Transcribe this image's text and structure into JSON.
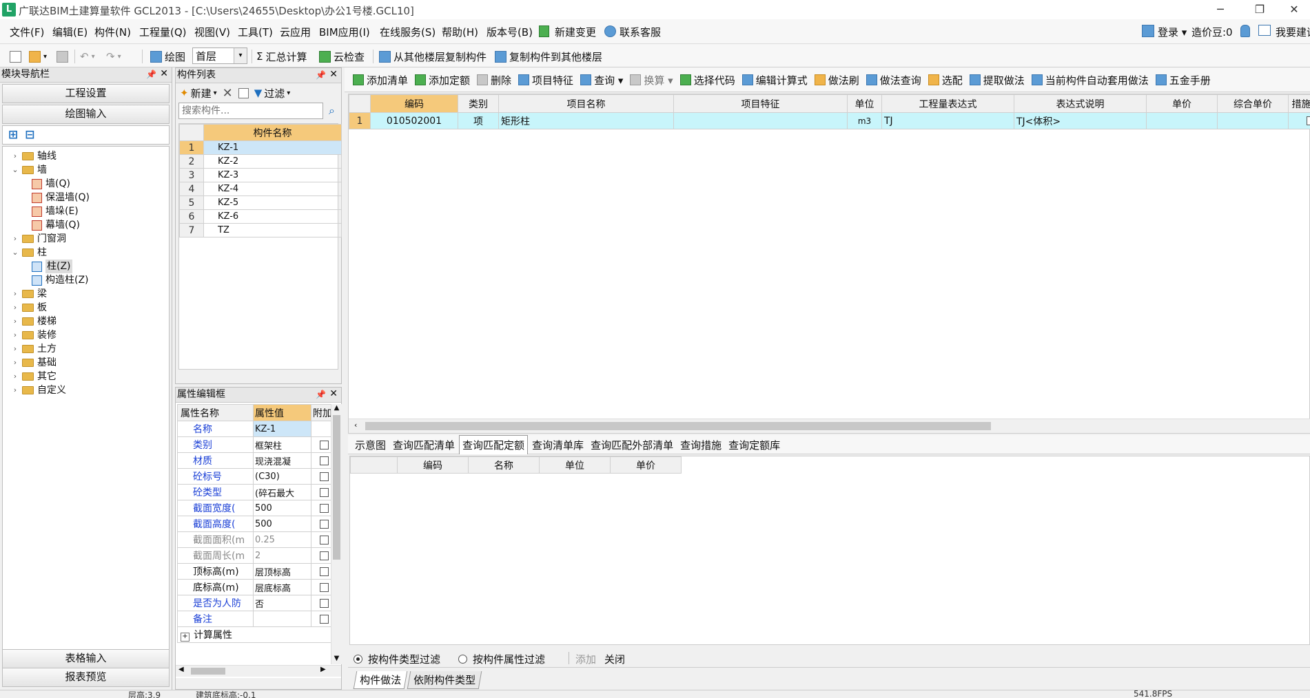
{
  "window": {
    "title": "广联达BIM土建算量软件 GCL2013 - [C:\\Users\\24655\\Desktop\\办公1号楼.GCL10]",
    "logo": "L"
  },
  "menu": [
    "文件(F)",
    "编辑(E)",
    "构件(N)",
    "工程量(Q)",
    "视图(V)",
    "工具(T)",
    "云应用",
    "BIM应用(I)",
    "在线服务(S)",
    "帮助(H)",
    "版本号(B)",
    "新建变更",
    "联系客服"
  ],
  "account": {
    "login": "登录 ▾",
    "price_bean": "造价豆:0",
    "build": "我要建议"
  },
  "toolbar": {
    "draw": "绘图",
    "floor": "首层",
    "sum": "汇总计算",
    "cloud_check": "云检查",
    "copy_from": "从其他楼层复制构件",
    "copy_to": "复制构件到其他楼层"
  },
  "nav": {
    "title": "模块导航栏",
    "project_settings": "工程设置",
    "draw_input": "绘图输入",
    "tree": [
      {
        "label": "轴线",
        "level": 0,
        "arrow": "›"
      },
      {
        "label": "墙",
        "level": 0,
        "arrow": "⌄"
      },
      {
        "label": "墙(Q)",
        "level": 1
      },
      {
        "label": "保温墙(Q)",
        "level": 1
      },
      {
        "label": "墙垛(E)",
        "level": 1
      },
      {
        "label": "幕墙(Q)",
        "level": 1
      },
      {
        "label": "门窗洞",
        "level": 0,
        "arrow": "›"
      },
      {
        "label": "柱",
        "level": 0,
        "arrow": "⌄"
      },
      {
        "label": "柱(Z)",
        "level": 1
      },
      {
        "label": "构造柱(Z)",
        "level": 1
      },
      {
        "label": "梁",
        "level": 0,
        "arrow": "›"
      },
      {
        "label": "板",
        "level": 0,
        "arrow": "›"
      },
      {
        "label": "楼梯",
        "level": 0,
        "arrow": "›"
      },
      {
        "label": "装修",
        "level": 0,
        "arrow": "›"
      },
      {
        "label": "土方",
        "level": 0,
        "arrow": "›"
      },
      {
        "label": "基础",
        "level": 0,
        "arrow": "›"
      },
      {
        "label": "其它",
        "level": 0,
        "arrow": "›"
      },
      {
        "label": "自定义",
        "level": 0,
        "arrow": "›"
      }
    ],
    "table_input": "表格输入",
    "report_preview": "报表预览"
  },
  "components": {
    "title": "构件列表",
    "new": "新建",
    "filter": "过滤",
    "search_placeholder": "搜索构件...",
    "col_name": "构件名称",
    "rows": [
      {
        "n": "1",
        "name": "KZ-1"
      },
      {
        "n": "2",
        "name": "KZ-2"
      },
      {
        "n": "3",
        "name": "KZ-3"
      },
      {
        "n": "4",
        "name": "KZ-4"
      },
      {
        "n": "5",
        "name": "KZ-5"
      },
      {
        "n": "6",
        "name": "KZ-6"
      },
      {
        "n": "7",
        "name": "TZ"
      }
    ]
  },
  "props": {
    "title": "属性编辑框",
    "col_name": "属性名称",
    "col_value": "属性值",
    "col_extra": "附加",
    "rows": [
      {
        "name": "名称",
        "value": "KZ-1",
        "blue": true,
        "check": false,
        "hl": true
      },
      {
        "name": "类别",
        "value": "框架柱",
        "blue": true,
        "check": true
      },
      {
        "name": "材质",
        "value": "现浇混凝",
        "blue": true,
        "check": true
      },
      {
        "name": "砼标号",
        "value": "(C30)",
        "blue": true,
        "check": true
      },
      {
        "name": "砼类型",
        "value": "(碎石最大",
        "blue": true,
        "check": true
      },
      {
        "name": "截面宽度(",
        "value": "500",
        "blue": true,
        "check": true
      },
      {
        "name": "截面高度(",
        "value": "500",
        "blue": true,
        "check": true
      },
      {
        "name": "截面面积(m",
        "value": "0.25",
        "gray": true,
        "check": true
      },
      {
        "name": "截面周长(m",
        "value": "2",
        "gray": true,
        "check": true
      },
      {
        "name": "顶标高(m)",
        "value": "层顶标高",
        "check": true
      },
      {
        "name": "底标高(m)",
        "value": "层底标高",
        "check": true
      },
      {
        "name": "是否为人防",
        "value": "否",
        "blue": true,
        "check": true
      },
      {
        "name": "备注",
        "value": "",
        "blue": true,
        "check": true
      }
    ],
    "calc_attr": "计算属性"
  },
  "toolbar3": [
    "添加清单",
    "添加定额",
    "删除",
    "项目特征",
    "查询 ▾",
    "换算 ▾",
    "选择代码",
    "编辑计算式",
    "做法刷",
    "做法查询",
    "选配",
    "提取做法",
    "当前构件自动套用做法",
    "五金手册"
  ],
  "main_grid": {
    "headers": [
      "编码",
      "类别",
      "项目名称",
      "项目特征",
      "单位",
      "工程量表达式",
      "表达式说明",
      "单价",
      "综合单价",
      "措施项目"
    ],
    "rows": [
      {
        "n": "1",
        "code": "010502001",
        "type": "项",
        "name": "矩形柱",
        "feature": "",
        "unit": "m3",
        "expr": "TJ",
        "desc": "TJ<体积>",
        "price": "",
        "total": ""
      }
    ]
  },
  "lower": {
    "tabs": [
      "示意图",
      "查询匹配清单",
      "查询匹配定额",
      "查询清单库",
      "查询匹配外部清单",
      "查询措施",
      "查询定额库"
    ],
    "active_tab": "查询匹配定额",
    "headers": [
      "编码",
      "名称",
      "单位",
      "单价"
    ],
    "radio1": "按构件类型过滤",
    "radio2": "按构件属性过滤",
    "add": "添加",
    "close": "关闭",
    "bottom_tabs": [
      "构件做法",
      "依附构件类型"
    ]
  },
  "status": {
    "floor": "层高:3.9",
    "elev": "建筑底标高:-0.1",
    "right": "541.8FPS"
  }
}
